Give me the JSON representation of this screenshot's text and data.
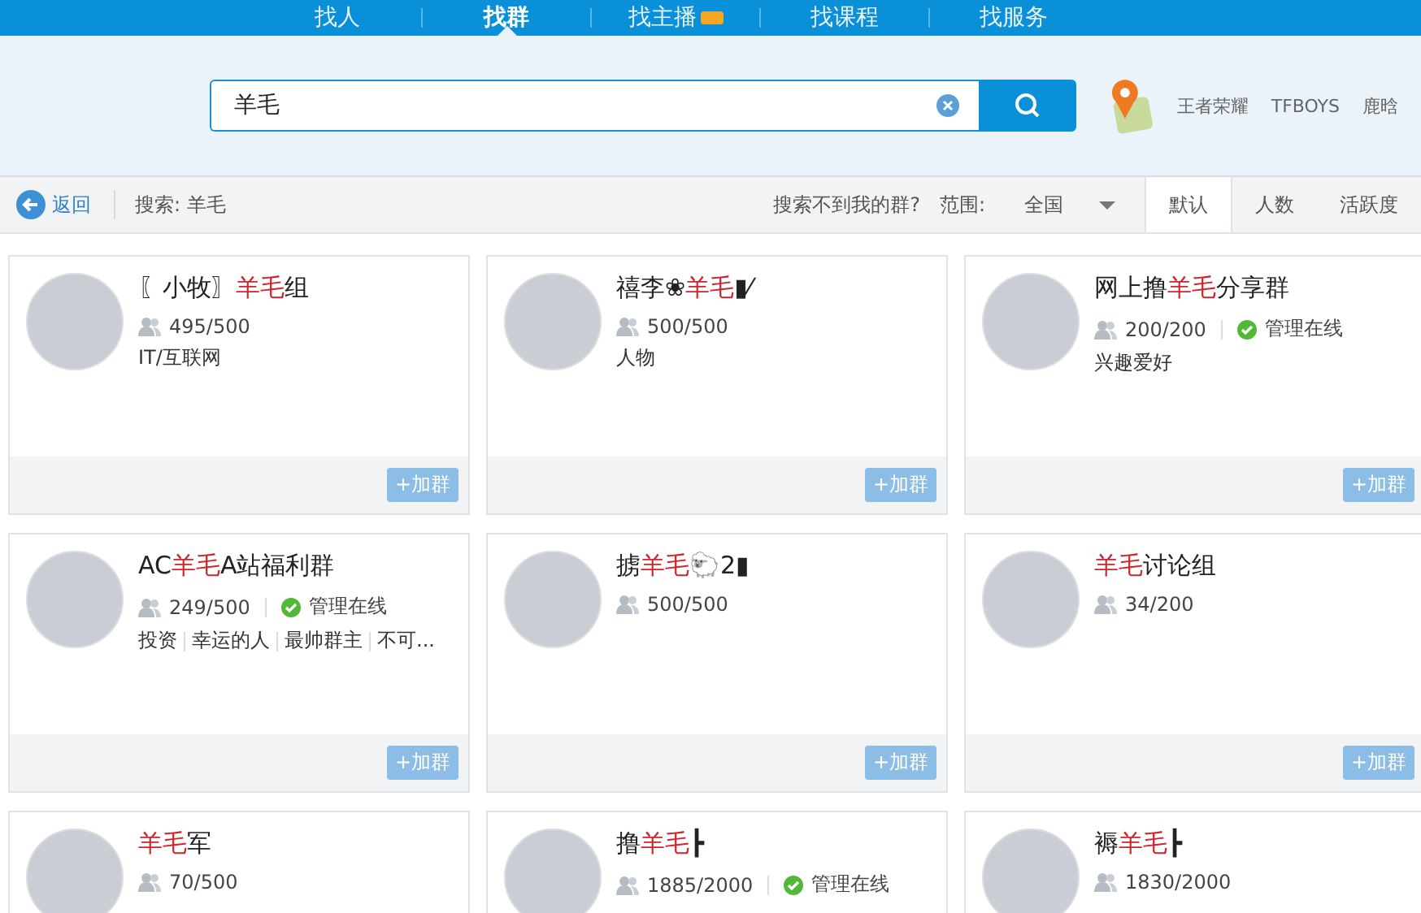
{
  "nav": {
    "tabs": [
      {
        "label": "找人",
        "selected": false,
        "badge": false
      },
      {
        "label": "找群",
        "selected": true,
        "badge": false
      },
      {
        "label": "找主播",
        "selected": false,
        "badge": true
      },
      {
        "label": "找课程",
        "selected": false,
        "badge": false
      },
      {
        "label": "找服务",
        "selected": false,
        "badge": false
      }
    ]
  },
  "search": {
    "value": "羊毛",
    "hot_words": [
      "王者荣耀",
      "TFBOYS",
      "鹿晗"
    ]
  },
  "toolbar": {
    "back": "返回",
    "query_label": "搜索: 羊毛",
    "not_found": "搜索不到我的群?",
    "range_label": "范围:",
    "range_value": "全国",
    "sort_tabs": [
      {
        "label": "默认",
        "selected": true
      },
      {
        "label": "人数",
        "selected": false
      },
      {
        "label": "活跃度",
        "selected": false
      }
    ]
  },
  "groups": [
    {
      "name": [
        {
          "text": "〖小牧〗",
          "highlight": false
        },
        {
          "text": "羊毛",
          "highlight": true
        },
        {
          "text": "组",
          "highlight": false
        }
      ],
      "members": "495/500",
      "admin_online": false,
      "tags": [
        "IT/互联网"
      ],
      "join": "+加群"
    },
    {
      "name": [
        {
          "text": "禧李❀",
          "highlight": false
        },
        {
          "text": "羊毛",
          "highlight": true
        },
        {
          "text": "▮⁄",
          "highlight": false
        }
      ],
      "members": "500/500",
      "admin_online": false,
      "tags": [
        "人物"
      ],
      "join": "+加群"
    },
    {
      "name": [
        {
          "text": "网上撸",
          "highlight": false
        },
        {
          "text": "羊毛",
          "highlight": true
        },
        {
          "text": "分享群",
          "highlight": false
        }
      ],
      "members": "200/200",
      "admin_online": true,
      "admin_label": "管理在线",
      "tags": [
        "兴趣爱好"
      ],
      "join": "+加群"
    },
    {
      "name": [
        {
          "text": "AC",
          "highlight": false
        },
        {
          "text": "羊毛",
          "highlight": true
        },
        {
          "text": "A站福利群",
          "highlight": false
        }
      ],
      "members": "249/500",
      "admin_online": true,
      "admin_label": "管理在线",
      "tags": [
        "投资",
        "幸运的人",
        "最帅群主",
        "不可..."
      ],
      "join": "+加群"
    },
    {
      "name": [
        {
          "text": "掳",
          "highlight": false
        },
        {
          "text": "羊毛",
          "highlight": true
        },
        {
          "text": "🐑2▮",
          "highlight": false
        }
      ],
      "members": "500/500",
      "admin_online": false,
      "join": "+加群"
    },
    {
      "name": [
        {
          "text": "羊毛",
          "highlight": true
        },
        {
          "text": "讨论组",
          "highlight": false
        }
      ],
      "members": "34/200",
      "admin_online": false,
      "join": "+加群"
    },
    {
      "name": [
        {
          "text": "羊毛",
          "highlight": true
        },
        {
          "text": "军",
          "highlight": false
        }
      ],
      "members": "70/500",
      "admin_online": false
    },
    {
      "name": [
        {
          "text": "撸",
          "highlight": false
        },
        {
          "text": "羊毛",
          "highlight": true
        },
        {
          "text": "┣",
          "highlight": false
        }
      ],
      "members": "1885/2000",
      "admin_online": true,
      "admin_label": "管理在线"
    },
    {
      "name": [
        {
          "text": "褥",
          "highlight": false
        },
        {
          "text": "羊毛",
          "highlight": true
        },
        {
          "text": "┣",
          "highlight": false
        }
      ],
      "members": "1830/2000",
      "admin_online": false
    }
  ]
}
